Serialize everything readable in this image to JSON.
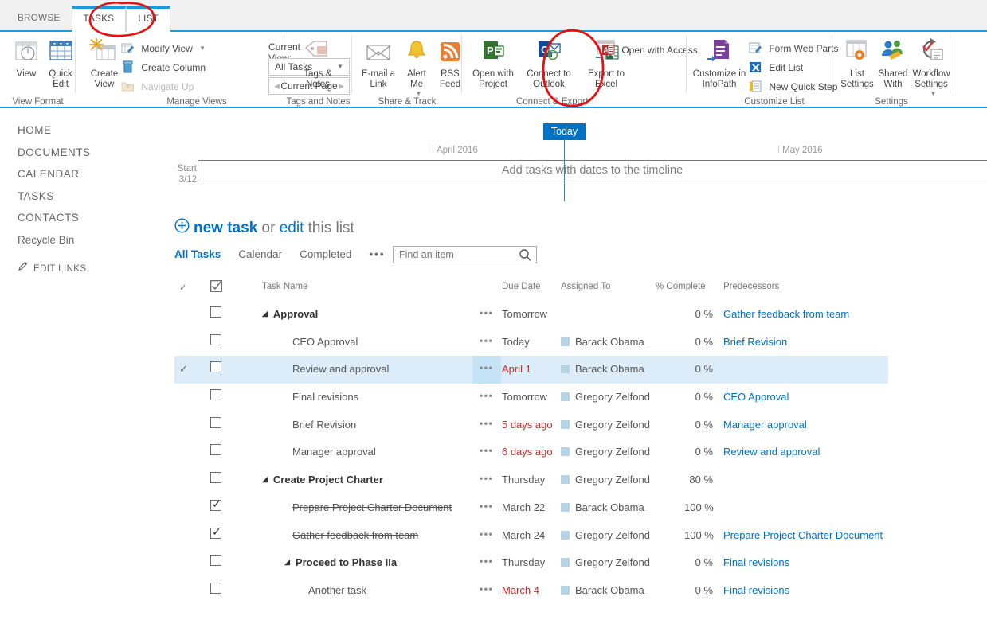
{
  "window": {
    "top_tabs": [
      {
        "id": "browse",
        "label": "BROWSE",
        "selected": false
      },
      {
        "id": "tasks",
        "label": "TASKS",
        "selected": true
      },
      {
        "id": "list",
        "label": "LIST",
        "selected": true
      }
    ]
  },
  "ribbon": {
    "groups": [
      {
        "id": "view-format",
        "label": "View Format"
      },
      {
        "id": "manage-views",
        "label": "Manage Views"
      },
      {
        "id": "tags-and-notes",
        "label": "Tags and Notes"
      },
      {
        "id": "share-and-track",
        "label": "Share & Track"
      },
      {
        "id": "connect-and-export",
        "label": "Connect & Export"
      },
      {
        "id": "customize-list",
        "label": "Customize List"
      },
      {
        "id": "settings",
        "label": "Settings"
      }
    ],
    "view_format": {
      "view": "View",
      "quick_edit_line1": "Quick",
      "quick_edit_line2": "Edit"
    },
    "manage_views": {
      "create_view_line1": "Create",
      "create_view_line2": "View",
      "modify_view": "Modify View",
      "create_column": "Create Column",
      "navigate_up": "Navigate Up",
      "current_view_label": "Current View:",
      "current_view_value": "All Tasks",
      "current_page": "Current Page"
    },
    "tags_notes": {
      "line1": "Tags &",
      "line2": "Notes"
    },
    "share_track": {
      "email_line1": "E-mail a",
      "email_line2": "Link",
      "alert_line1": "Alert",
      "alert_line2": "Me",
      "rss_line1": "RSS",
      "rss_line2": "Feed"
    },
    "connect_export": {
      "project_line1": "Open with",
      "project_line2": "Project",
      "outlook_line1": "Connect to",
      "outlook_line2": "Outlook",
      "excel_line1": "Export to",
      "excel_line2": "Excel",
      "open_with_access": "Open with Access"
    },
    "customize_list": {
      "infopath_line1": "Customize in",
      "infopath_line2": "InfoPath",
      "form_web_parts": "Form Web Parts",
      "edit_list": "Edit List",
      "new_quick_step": "New Quick Step"
    },
    "settings": {
      "list_settings_line1": "List",
      "list_settings_line2": "Settings",
      "shared_with_line1": "Shared",
      "shared_with_line2": "With",
      "workflow_line1": "Workflow",
      "workflow_line2": "Settings"
    }
  },
  "sidebar": {
    "items": [
      {
        "label": "HOME",
        "mixed": false
      },
      {
        "label": "DOCUMENTS",
        "mixed": false
      },
      {
        "label": "CALENDAR",
        "mixed": false
      },
      {
        "label": "TASKS",
        "mixed": false
      },
      {
        "label": "CONTACTS",
        "mixed": false
      },
      {
        "label": "Recycle Bin",
        "mixed": true
      }
    ],
    "edit_links": "EDIT LINKS"
  },
  "timeline": {
    "today_label": "Today",
    "start_label": "Start",
    "start_date": "3/12",
    "months": [
      "April 2016",
      "May 2016"
    ],
    "placeholder": "Add tasks with dates to the timeline"
  },
  "toolbar": {
    "new_task": "new task",
    "or": " or ",
    "edit": "edit",
    "this_list": " this list"
  },
  "views": {
    "tabs": [
      {
        "label": "All Tasks",
        "active": true
      },
      {
        "label": "Calendar",
        "active": false
      },
      {
        "label": "Completed",
        "active": false
      },
      {
        "label": "•••",
        "active": false
      }
    ]
  },
  "search": {
    "value": "",
    "placeholder": "Find an item"
  },
  "table": {
    "columns": {
      "task_name": "Task Name",
      "due_date": "Due Date",
      "assigned_to": "Assigned To",
      "percent_complete": "% Complete",
      "predecessors": "Predecessors"
    },
    "rows": [
      {
        "name": "Approval",
        "indent": "ind1",
        "group": true,
        "checked": false,
        "selected": false,
        "strike": false,
        "due": "Tomorrow",
        "due_late": false,
        "assigned": "",
        "pct": "0 %",
        "pred": "Gather feedback from team"
      },
      {
        "name": "CEO Approval",
        "indent": "ind2",
        "group": false,
        "checked": false,
        "selected": false,
        "strike": false,
        "due": "Today",
        "due_late": false,
        "assigned": "Barack Obama",
        "pct": "0 %",
        "pred": "Brief Revision"
      },
      {
        "name": "Review and approval",
        "indent": "ind2",
        "group": false,
        "checked": false,
        "selected": true,
        "strike": false,
        "due": "April 1",
        "due_late": true,
        "assigned": "Barack Obama",
        "pct": "0 %",
        "pred": ""
      },
      {
        "name": "Final revisions",
        "indent": "ind2",
        "group": false,
        "checked": false,
        "selected": false,
        "strike": false,
        "due": "Tomorrow",
        "due_late": false,
        "assigned": "Gregory Zelfond",
        "pct": "0 %",
        "pred": "CEO Approval"
      },
      {
        "name": "Brief Revision",
        "indent": "ind2",
        "group": false,
        "checked": false,
        "selected": false,
        "strike": false,
        "due": "5 days ago",
        "due_late": true,
        "assigned": "Gregory Zelfond",
        "pct": "0 %",
        "pred": "Manager approval"
      },
      {
        "name": "Manager approval",
        "indent": "ind2",
        "group": false,
        "checked": false,
        "selected": false,
        "strike": false,
        "due": "6 days ago",
        "due_late": true,
        "assigned": "Gregory Zelfond",
        "pct": "0 %",
        "pred": "Review and approval"
      },
      {
        "name": "Create Project Charter",
        "indent": "ind1",
        "group": true,
        "checked": false,
        "selected": false,
        "strike": false,
        "due": "Thursday",
        "due_late": false,
        "assigned": "Gregory Zelfond",
        "pct": "80 %",
        "pred": ""
      },
      {
        "name": "Prepare Project Charter Document",
        "indent": "ind2",
        "group": false,
        "checked": true,
        "selected": false,
        "strike": true,
        "due": "March 22",
        "due_late": false,
        "assigned": "Barack Obama",
        "pct": "100 %",
        "pred": ""
      },
      {
        "name": "Gather feedback from team",
        "indent": "ind2",
        "group": false,
        "checked": true,
        "selected": false,
        "strike": true,
        "due": "March 24",
        "due_late": false,
        "assigned": "Gregory Zelfond",
        "pct": "100 %",
        "pred": "Prepare Project Charter Document"
      },
      {
        "name": "Proceed to Phase IIa",
        "indent": "ind3",
        "group": true,
        "checked": false,
        "selected": false,
        "strike": false,
        "due": "Thursday",
        "due_late": false,
        "assigned": "Gregory Zelfond",
        "pct": "0 %",
        "pred": "Final revisions"
      },
      {
        "name": "Another task",
        "indent": "ind4",
        "group": false,
        "checked": false,
        "selected": false,
        "strike": false,
        "due": "March 4",
        "due_late": true,
        "assigned": "Barack Obama",
        "pct": "0 %",
        "pred": "Final revisions"
      }
    ]
  },
  "annotations": {
    "color": "#e81010",
    "shapes": [
      {
        "name": "list-tab-circle"
      },
      {
        "name": "export-to-excel-circle"
      }
    ]
  },
  "colors": {
    "accent": "#0072c6",
    "tab_underline": "#1a9bd7",
    "row_highlight": "#dcedf9",
    "overdue": "#cc2b2b",
    "annotation": "#e81010"
  }
}
